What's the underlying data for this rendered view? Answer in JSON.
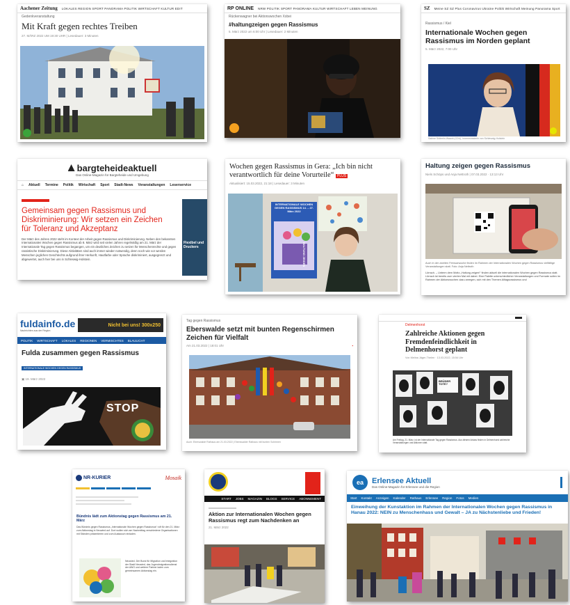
{
  "cards": {
    "aachener": {
      "brand": "Aachener Zeitung",
      "nav": "LOKALES REGION SPORT PANORAMA POLITIK WIRTSCHAFT KULTUR EDIT",
      "kicker": "Gedenkveranstaltung",
      "headline": "Mit Kraft gegen rechtes Treiben",
      "meta": "27. MÄRZ 2022 UM 19:30 UHR | Lesedauer: 3 Minuten"
    },
    "rponline": {
      "brand": "RP ONLINE",
      "nav": "NRW POLITIK SPORT PANORAMA KULTUR WIRTSCHAFT LEBEN MEINUNG",
      "kicker": "Rückenwagner bei Aktionswochen Xxbei",
      "headline": "#haltungzeigen gegen Rassismus",
      "meta": "5. März 2022 um 6:00 Uhr | Lesedauer: 2 Minuten"
    },
    "sz": {
      "brand": "SZ",
      "nav": "Meine SZ  SZ Plus  Coronavirus  Ukraine  Politik  Wirtschaft  Meinung  Panorama  Sport",
      "kicker": "Rassismus / Kiel",
      "headline": "Internationale Wochen gegen Rassismus im Norden geplant",
      "meta": "5. März 2022, 7:00 Uhr",
      "caption": "Sabine Sütterlin-Waack (CDU), Innenministerin von Schleswig-Holstein"
    },
    "bargteheide": {
      "brand": "bargteheideaktuell",
      "tagline": "Das Online-Magazin für Bargteheide und Umgebung",
      "nav": [
        "Aktuell",
        "Termine",
        "Politik",
        "Wirtschaft",
        "Sport",
        "Stadt-News",
        "Veranstaltungen",
        "Leserservice"
      ],
      "headline": "Gemeinsam gegen Rassismus und Diskriminierung: Wir setzen ein Zeichen für Toleranz und Akzeptanz",
      "body": "Der März des Jahres 2022 steht im Kontext der Arbeit gegen Rassismus und Diskriminierung. Neben den bekannten Internationalen Wochen gegen Rassismus ab 8. März wird seit vielen Jahren regelmäßig am 21. März der Internationale Tag gegen Rassismus begangen, um ein deutliches Zeichen zu setzen für Menschenrechte und gegen rassistische Diskriminierung. Diese Aktivitäten sind auch immer wieder notwendig, denn noch wie vor werden Menschen jeglichen Geschlechts aufgrund ihrer Herkunft, Hautfarbe oder Sprache diskriminiert, ausgegrenzt und abgewertet, auch hier bei uns in Schleswig-Holstein.",
      "side_label": "Flexibel und Druckers"
    },
    "gera": {
      "headline": "Wochen gegen Rassismus in Gera: „Ich bin nicht verantwortlich für deine Vorurteile“",
      "badge": "PLUS",
      "meta": "Aktualisiert: 15.03.2022, 21:18 | Lesedauer: 3 Minuten",
      "poster_title": "INTERNATIONALE WOCHEN GEGEN RASSISMUS 14. – 27. März 2022",
      "poster_side": "HALTUNG ZEIGEN"
    },
    "haltung": {
      "headline": "Haltung zeigen gegen Rassismus",
      "meta": "Niels Schöps und Anja Nettroth | 07.03.2022 · 13:13 Uhr",
      "caption": "Auch in der zweiten Februarwoche finden im Rahmen der Internationalen Wochen gegen Rassismus vielfältige Veranstaltungen statt. Foto: Anja Nettroth",
      "body": "Lörrach. – Unterm dem Motto „Haltung zeigen!“ finden aktuell die internationalen Wochen gegen Rassismus statt. Lörrach ist bereits zum vierten Mal mit dabei. Eine Palette unterschiedlicher Veranstaltungen und Formate sollen im Rahmen der Aktionswochen dazu anregen, sich mit den Themen Alltagsrassismus und"
    },
    "fuldainfo": {
      "brand": "fuldainfo.de",
      "brand_sub": "Nachrichten aus der Region",
      "ad": "Nicht bei uns! 300x250",
      "nav": [
        "POLITIK",
        "WIRTSCHAFT",
        "LOKALES",
        "REGIONEN",
        "VERMISCHTES",
        "BLAULICHT"
      ],
      "headline": "Fulda zusammen gegen Rassismus",
      "tag": "INTERNATIONALE WOCHEN GEGEN RASSISMUS",
      "meta": "19. März 2022",
      "image_text": "STOP"
    },
    "eberswalde": {
      "kicker": "Tag gegen Rassismus",
      "headline": "Eberswalde setzt mit bunten Regenschirmen Zeichen für Vielfalt",
      "meta": "Am 21.03.2022 | 18:01 Uhr",
      "caption": "Auch: Eberswalde Rathaus am 21.03.2022 | Eberswalder Rathaus mit bunten Schirmen"
    },
    "delmenhorst": {
      "kicker": "Delmenhorst",
      "headline": "Zahlreiche Aktionen gegen Fremdenfeindlichkeit in Delmenhorst geplant",
      "meta": "Von Melina Jäger-Thelen · 13.03.2022, 15:54 Uhr",
      "sign_text": "BRÜDER TOTE?",
      "body": "Am Freitag, 21. März, ist der Internationale Tag gegen Rassismus. Aus diesem Anlass finden in Delmenhorst zahlreiche Veranstaltungen und Aktionen statt."
    },
    "nnkurier": {
      "brand": "NR-KURIER",
      "mosaik": "Mosaik",
      "headline": "Bündnis lädt zum Aktionstag gegen Rassismus am 21. März",
      "body": "Das Bündnis gegen Rassismus „Internationale Wochen gegen Rassismus“ ruft für den 21. März zum Aktionstag in Neuwied auf. Dort wollen sich am Nachmittag verschiedene Organisationen mit Ständen präsentieren und zum Austausch einladen.",
      "body2": "Neuwied. Der Bund für Migration und Integration der Stadt Neuwied, das Jugendmigrationsdienst der AWO und weitere Partner laden zum gemeinsamen Aktionstag ein."
    },
    "aktion": {
      "nav": [
        "START",
        "JOBS",
        "MAGAZIN",
        "BLOGS",
        "SERVICE",
        "ABONNEMENT"
      ],
      "headline": "Aktion zur Internationalen Wochen gegen Rassismus regt zum Nachdenken an",
      "meta": "21. März 2022"
    },
    "erlensee": {
      "brand": "Erlensee Aktuell",
      "tagline": "Das Online-Magazin für Erlensee und die Region",
      "nav": [
        "Start",
        "Kontakt",
        "Anzeigen",
        "Kalender",
        "Rathaus",
        "Erlensee",
        "Region",
        "Fotos",
        "Medien"
      ],
      "headline": "Einweihung der Kunstaktion im Rahmen der Internationalen Wochen gegen Rassismus in Hanau 2022: NEIN zu Menschenhass und Gewalt – JA zu Nächstenliebe und Frieden!"
    }
  },
  "colors": {
    "bargteheide_red": "#e2231a",
    "fulda_blue": "#1b5aa3",
    "sz_dark": "#1c1c1c",
    "erlensee_blue": "#1a6fb5",
    "rp_dark": "#111111"
  }
}
